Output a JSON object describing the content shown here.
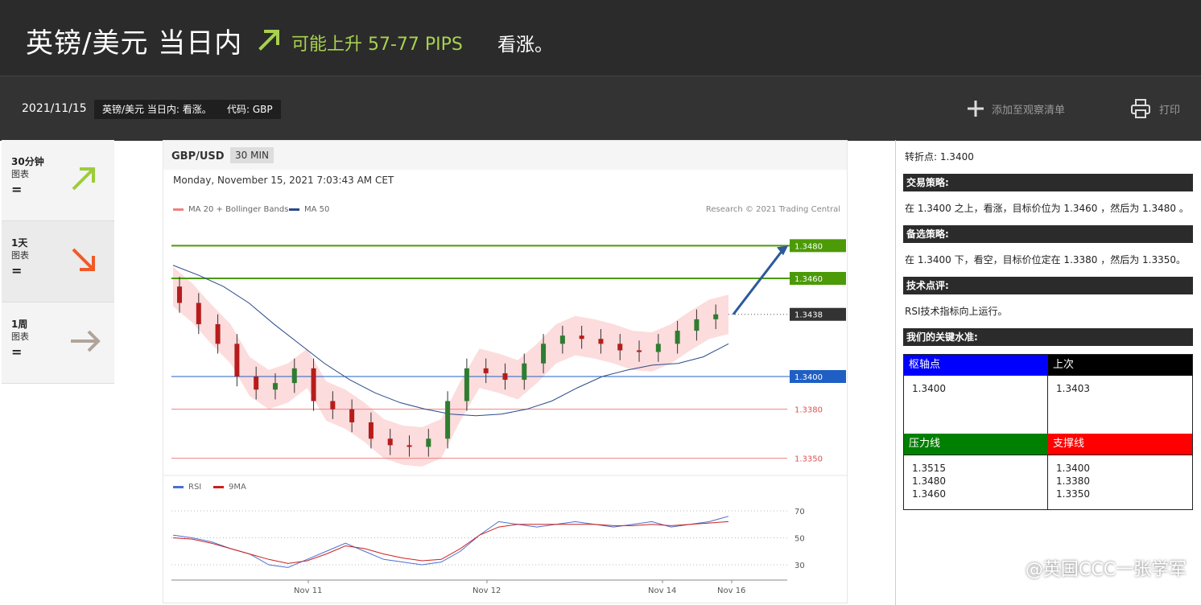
{
  "header": {
    "title": "英镑/美元 当日内",
    "potential": "可能上升 57-77 PIPS",
    "view": "看涨。",
    "accent_color": "#a8d14f"
  },
  "subbar": {
    "date": "2021/11/15",
    "tag_view": "英镑/美元 当日内: 看涨。",
    "tag_code": "代码: GBP",
    "watchlist": "添加至观察清单",
    "print": "打印"
  },
  "timeframes": [
    {
      "label": "30分钟",
      "sub": "图表",
      "sign": "=",
      "icon": "arrow-up-right-icon",
      "color": "#9ccc3c"
    },
    {
      "label": "1天",
      "sub": "图表",
      "sign": "=",
      "icon": "arrow-down-right-icon",
      "color": "#f05a28"
    },
    {
      "label": "1周",
      "sub": "图表",
      "sign": "=",
      "icon": "arrow-right-icon",
      "color": "#b0a49a"
    }
  ],
  "chart": {
    "pair": "GBP/USD",
    "interval": "30 MIN",
    "timestamp": "Monday, November 15, 2021 7:03:43 AM CET",
    "legend_ma20": "MA 20 + Bollinger Bands",
    "legend_ma50": "MA 50",
    "credit": "Research © 2021 Trading Central",
    "rsi_legend": "RSI",
    "rsi_ma_legend": "9MA"
  },
  "chart_data": {
    "type": "line",
    "title": "GBP/USD",
    "x_ticks": [
      "Nov 11",
      "Nov 12",
      "Nov 14",
      "Nov 16"
    ],
    "price_series": [
      1.3455,
      1.3445,
      1.3432,
      1.342,
      1.34,
      1.3392,
      1.3396,
      1.3405,
      1.3385,
      1.338,
      1.3372,
      1.3362,
      1.3358,
      1.3357,
      1.3362,
      1.3385,
      1.3405,
      1.3402,
      1.3398,
      1.3408,
      1.342,
      1.3425,
      1.3423,
      1.342,
      1.3416,
      1.3415,
      1.342,
      1.3428,
      1.3435,
      1.3438
    ],
    "ma50_series": [
      1.3468,
      1.3462,
      1.3455,
      1.3445,
      1.3432,
      1.342,
      1.3408,
      1.3398,
      1.339,
      1.3384,
      1.338,
      1.3377,
      1.3376,
      1.3377,
      1.338,
      1.3385,
      1.3393,
      1.34,
      1.3404,
      1.3407,
      1.3408,
      1.3412,
      1.342
    ],
    "levels": [
      {
        "label": "1.3480",
        "color": "#4c9a08",
        "style": "line"
      },
      {
        "label": "1.3460",
        "color": "#4c9a08",
        "style": "line"
      },
      {
        "label": "1.3438",
        "color": "#333333",
        "style": "dotted"
      },
      {
        "label": "1.3400",
        "color": "#1f5fc4",
        "style": "line"
      },
      {
        "label": "1.3380",
        "color": "#f08080",
        "style": "line"
      },
      {
        "label": "1.3350",
        "color": "#f08080",
        "style": "line"
      }
    ],
    "rsi_ticks": [
      "70",
      "50",
      "30"
    ],
    "rsi_series": [
      52,
      50,
      47,
      42,
      38,
      30,
      28,
      34,
      40,
      46,
      40,
      34,
      32,
      30,
      32,
      40,
      52,
      62,
      60,
      58,
      60,
      62,
      60,
      58,
      60,
      62,
      58,
      60,
      62,
      66
    ],
    "rsi_ma_series": [
      50,
      49,
      46,
      42,
      38,
      34,
      31,
      33,
      38,
      44,
      42,
      38,
      35,
      33,
      34,
      42,
      52,
      58,
      60,
      60,
      60,
      60,
      60,
      59,
      59,
      60,
      59,
      60,
      61,
      62
    ]
  },
  "analysis": {
    "pivot_line": "转折点: 1.3400",
    "strategy_title": "交易策略:",
    "strategy_text": "在 1.3400 之上，看涨，目标价位为 1.3460 ，然后为 1.3480 。",
    "alt_title": "备选策略:",
    "alt_text": "在 1.3400 下，看空，目标价位定在 1.3380 ，然后为 1.3350。",
    "comment_title": "技术点评:",
    "comment_text": "RSI技术指标向上运行。",
    "levels_title": "我们的关键水准:",
    "table": {
      "pivot_header": "枢轴点",
      "last_header": "上次",
      "pivot_value": "1.3400",
      "last_value": "1.3403",
      "res_header": "压力线",
      "sup_header": "支撑线",
      "res_values": [
        "1.3515",
        "1.3480",
        "1.3460"
      ],
      "sup_values": [
        "1.3400",
        "1.3380",
        "1.3350"
      ],
      "colors": {
        "pivot": "#0000ff",
        "last": "#000000",
        "res": "#008000",
        "sup": "#ff0000"
      }
    }
  },
  "watermark": "@英国CCC一张学军"
}
